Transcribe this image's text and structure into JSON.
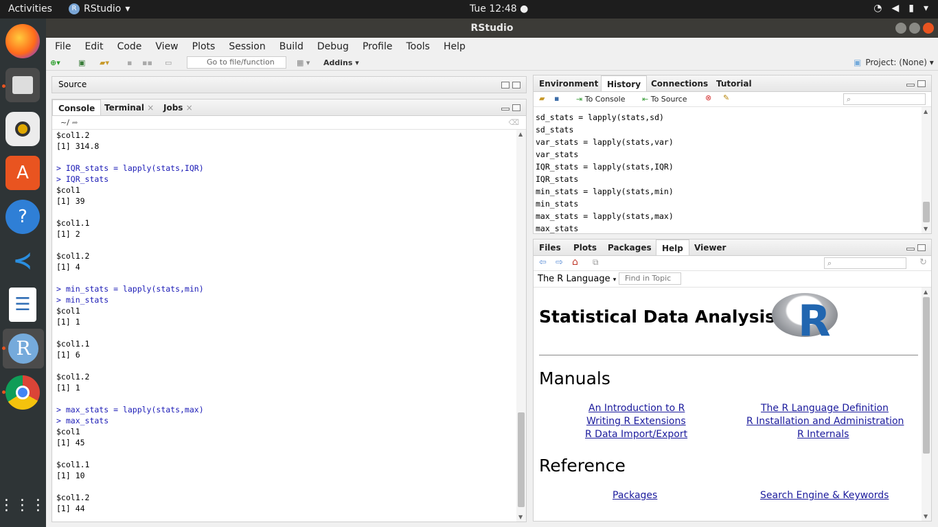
{
  "topbar": {
    "activities": "Activities",
    "app_name": "RStudio",
    "app_letter": "R",
    "clock": "Tue 12:48 ●"
  },
  "window": {
    "title": "RStudio"
  },
  "menu": [
    "File",
    "Edit",
    "Code",
    "View",
    "Plots",
    "Session",
    "Build",
    "Debug",
    "Profile",
    "Tools",
    "Help"
  ],
  "toolbar": {
    "goto_placeholder": "Go to file/function",
    "addins": "Addins",
    "project": "Project: (None)"
  },
  "source": {
    "title": "Source"
  },
  "console": {
    "tabs": [
      "Console",
      "Terminal",
      "Jobs"
    ],
    "path": "~/",
    "lines": [
      {
        "t": "out",
        "text": "$col1.2"
      },
      {
        "t": "out",
        "text": "[1] 314.8"
      },
      {
        "t": "out",
        "text": ""
      },
      {
        "t": "cmd",
        "text": "> IQR_stats = lapply(stats,IQR)"
      },
      {
        "t": "cmd",
        "text": "> IQR_stats"
      },
      {
        "t": "out",
        "text": "$col1"
      },
      {
        "t": "out",
        "text": "[1] 39"
      },
      {
        "t": "out",
        "text": ""
      },
      {
        "t": "out",
        "text": "$col1.1"
      },
      {
        "t": "out",
        "text": "[1] 2"
      },
      {
        "t": "out",
        "text": ""
      },
      {
        "t": "out",
        "text": "$col1.2"
      },
      {
        "t": "out",
        "text": "[1] 4"
      },
      {
        "t": "out",
        "text": ""
      },
      {
        "t": "cmd",
        "text": "> min_stats = lapply(stats,min)"
      },
      {
        "t": "cmd",
        "text": "> min_stats"
      },
      {
        "t": "out",
        "text": "$col1"
      },
      {
        "t": "out",
        "text": "[1] 1"
      },
      {
        "t": "out",
        "text": ""
      },
      {
        "t": "out",
        "text": "$col1.1"
      },
      {
        "t": "out",
        "text": "[1] 6"
      },
      {
        "t": "out",
        "text": ""
      },
      {
        "t": "out",
        "text": "$col1.2"
      },
      {
        "t": "out",
        "text": "[1] 1"
      },
      {
        "t": "out",
        "text": ""
      },
      {
        "t": "cmd",
        "text": "> max_stats = lapply(stats,max)"
      },
      {
        "t": "cmd",
        "text": "> max_stats"
      },
      {
        "t": "out",
        "text": "$col1"
      },
      {
        "t": "out",
        "text": "[1] 45"
      },
      {
        "t": "out",
        "text": ""
      },
      {
        "t": "out",
        "text": "$col1.1"
      },
      {
        "t": "out",
        "text": "[1] 10"
      },
      {
        "t": "out",
        "text": ""
      },
      {
        "t": "out",
        "text": "$col1.2"
      },
      {
        "t": "out",
        "text": "[1] 44"
      }
    ]
  },
  "env": {
    "tabs": [
      "Environment",
      "History",
      "Connections",
      "Tutorial"
    ],
    "to_console": "To Console",
    "to_source": "To Source",
    "history": [
      "sd_stats = lapply(stats,sd)",
      "sd_stats",
      "var_stats = lapply(stats,var)",
      "var_stats",
      "IQR_stats = lapply(stats,IQR)",
      "IQR_stats",
      "min_stats = lapply(stats,min)",
      "min_stats",
      "max_stats = lapply(stats,max)",
      "max_stats"
    ]
  },
  "files": {
    "tabs": [
      "Files",
      "Plots",
      "Packages",
      "Help",
      "Viewer"
    ],
    "topic": "The R Language",
    "find_placeholder": "Find in Topic"
  },
  "help": {
    "heading": "Statistical Data Analysis",
    "logo_letter": "R",
    "manuals": "Manuals",
    "links_left": [
      "An Introduction to R",
      "Writing R Extensions",
      "R Data Import/Export"
    ],
    "links_right": [
      "The R Language Definition",
      "R Installation and Administration",
      "R Internals"
    ],
    "reference": "Reference",
    "ref_left": "Packages",
    "ref_right": "Search Engine & Keywords"
  }
}
